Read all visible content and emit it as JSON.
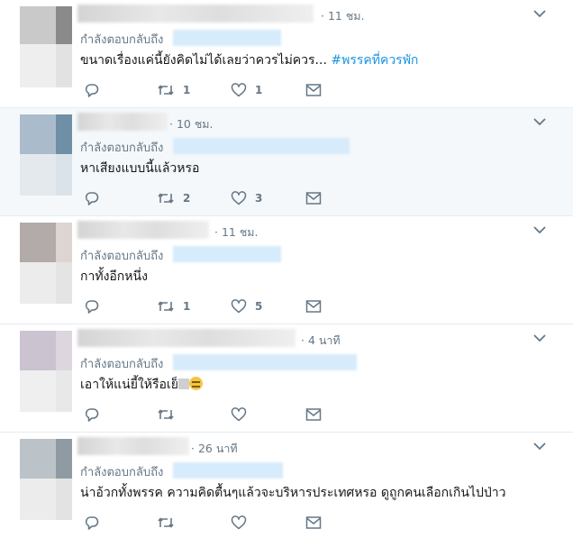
{
  "tweets": [
    {
      "time": "· 11 ชม.",
      "reply_label": "กำลังตอบกลับถึง",
      "text": "ขนาดเรื่องแค่นี้ยังคิดไม่ได้เลยว่าควรไม่ควร...",
      "hashtag": "#พรรคที่ควรพัก",
      "replies": "",
      "retweets": "1",
      "likes": "1"
    },
    {
      "time": "· 10 ชม.",
      "reply_label": "กำลังตอบกลับถึง",
      "text": "หาเสียงแบบนี้แล้วหรอ",
      "replies": "",
      "retweets": "2",
      "likes": "3"
    },
    {
      "time": "· 11 ชม.",
      "reply_label": "กำลังตอบกลับถึง",
      "text": "กาทั้งอีกหนึ่ง",
      "replies": "",
      "retweets": "1",
      "likes": "5"
    },
    {
      "time": "· 4 นาที",
      "reply_label": "กำลังตอบกลับถึง",
      "text": "เอาให้แน่ยี้ให้รือเย็",
      "replies": "",
      "retweets": "",
      "likes": ""
    },
    {
      "time": "· 26 นาที",
      "reply_label": "กำลังตอบกลับถึง",
      "text": "น่าอ้วกทั้งพรรค ความคิดตื้นๆแล้วจะบริหารประเทศหรอ ดูถูกคนเลือกเกินไปป่าว",
      "replies": "",
      "retweets": "",
      "likes": ""
    }
  ],
  "colors": {
    "text": "#14171a",
    "secondary": "#657786",
    "link": "#1b95e0",
    "highlight_bg": "#f5f8fa",
    "border": "#e6ecf0"
  },
  "icons": [
    "reply-icon",
    "retweet-icon",
    "like-icon",
    "direct-message-icon",
    "chevron-down-icon"
  ]
}
